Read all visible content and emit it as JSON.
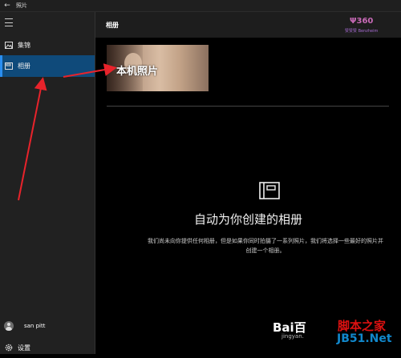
{
  "window": {
    "title": "照片",
    "back_glyph": "←"
  },
  "sidebar": {
    "items": [
      {
        "label": "集锦",
        "icon": "collection-icon"
      },
      {
        "label": "相册",
        "icon": "album-icon",
        "active": true
      }
    ],
    "user_name": "san pitt",
    "settings_label": "设置"
  },
  "header": {
    "title": "相册"
  },
  "album_tile": {
    "label": "本机照片"
  },
  "empty_state": {
    "title": "自动为你创建的相册",
    "description": "我们尚未向你提供任何相册，但是如果你同时拍摄了一系列照片，我们将选择一些最好的照片并创建一个相册。"
  },
  "watermarks": {
    "top_logo_text": "Ψ360",
    "top_logo_sub": "赞赞赞 Benzheim",
    "baidu": "Bai百",
    "jingyan": "jingyan.",
    "jb51_line1": "脚本之家",
    "jb51_line2": "JB51.Net"
  },
  "colors": {
    "active_nav": "#0f4a7a",
    "accent": "#2a8ef0",
    "annotation_arrow": "#e8232b"
  }
}
